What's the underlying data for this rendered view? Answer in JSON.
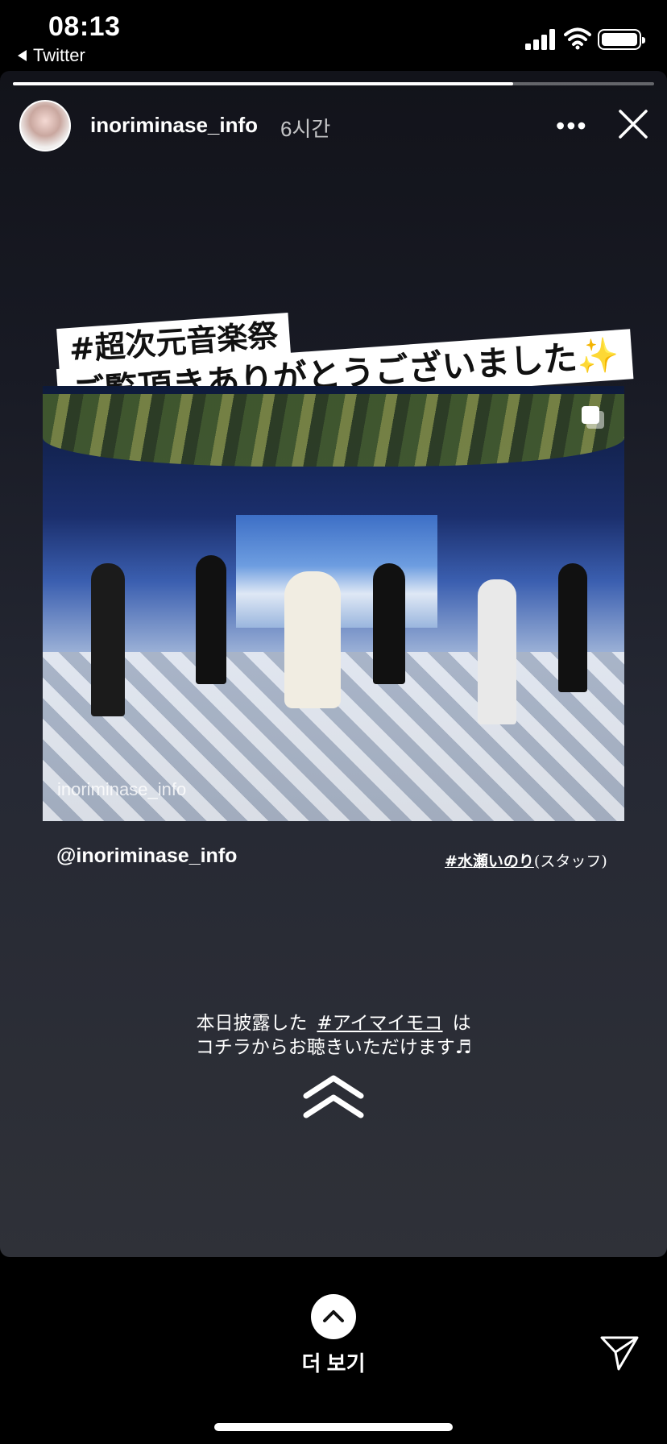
{
  "status_bar": {
    "time": "08:13",
    "back_label": "Twitter"
  },
  "story": {
    "progress": 0.78,
    "username": "inoriminase_info",
    "time_ago": "6시간",
    "more_label": "•••",
    "title_line1": "#超次元音楽祭",
    "title_line2": "ご覧頂きありがとうございました",
    "title_emoji": "✨",
    "photo_watermark": "inoriminase_info",
    "handle": "@inoriminase_info",
    "hashtag": "#水瀬いのり",
    "hashtag_suffix": "(スタッフ)",
    "note_prefix": "本日披露した",
    "note_tag": "#アイマイモコ",
    "note_suffix": "は",
    "note_line2": "コチラからお聴きいただけます♬"
  },
  "bottom": {
    "see_more_label": "더 보기"
  },
  "icons": [
    "signal-icon",
    "wifi-icon",
    "battery-icon",
    "more-icon",
    "close-icon",
    "multi-photo-icon",
    "swipe-up-icon",
    "chevron-up-icon",
    "send-icon"
  ],
  "colors": {
    "background": "#000000",
    "text": "#ffffff",
    "sparkle": "#e9c64a"
  }
}
